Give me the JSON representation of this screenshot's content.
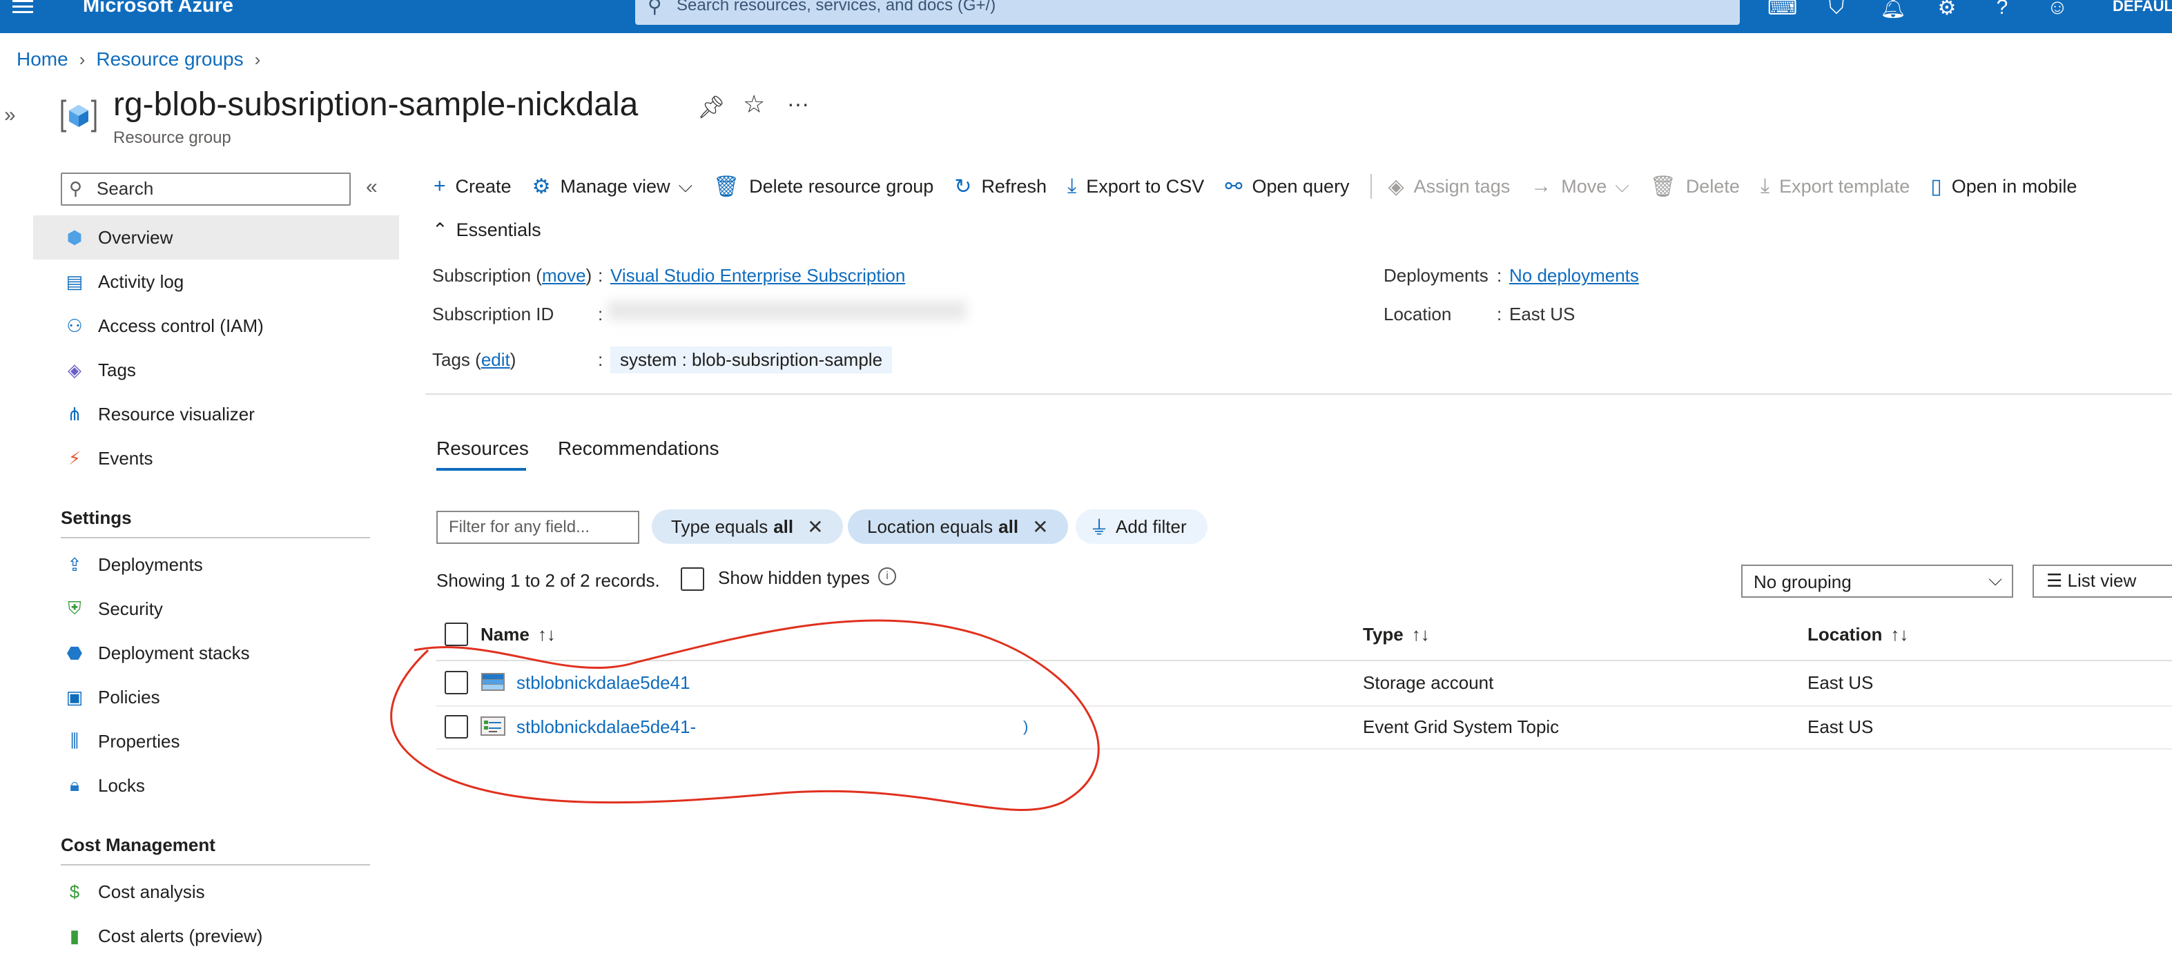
{
  "topbar": {
    "brand": "Microsoft Azure",
    "search_placeholder": "Search resources, services, and docs (G+/)",
    "directory": "DEFAULT"
  },
  "breadcrumb": [
    "Home",
    "Resource groups"
  ],
  "title": {
    "name": "rg-blob-subsription-sample-nickdala",
    "subtitle": "Resource group"
  },
  "nav": {
    "search_placeholder": "Search",
    "items": [
      {
        "label": "Overview",
        "icon": "resource-group-icon",
        "active": true
      },
      {
        "label": "Activity log",
        "icon": "activity-log-icon"
      },
      {
        "label": "Access control (IAM)",
        "icon": "people-icon"
      },
      {
        "label": "Tags",
        "icon": "tag-icon"
      },
      {
        "label": "Resource visualizer",
        "icon": "hierarchy-icon"
      },
      {
        "label": "Events",
        "icon": "lightning-icon"
      }
    ],
    "settings_header": "Settings",
    "settings_items": [
      {
        "label": "Deployments",
        "icon": "upload-icon"
      },
      {
        "label": "Security",
        "icon": "shield-icon"
      },
      {
        "label": "Deployment stacks",
        "icon": "cube-stack-icon"
      },
      {
        "label": "Policies",
        "icon": "policy-icon"
      },
      {
        "label": "Properties",
        "icon": "properties-icon"
      },
      {
        "label": "Locks",
        "icon": "lock-icon"
      }
    ],
    "cost_header": "Cost Management",
    "cost_items": [
      {
        "label": "Cost analysis",
        "icon": "cost-analysis-icon"
      },
      {
        "label": "Cost alerts (preview)",
        "icon": "cost-alert-icon"
      }
    ]
  },
  "commands": {
    "create": "Create",
    "manage_view": "Manage view",
    "delete_rg": "Delete resource group",
    "refresh": "Refresh",
    "export_csv": "Export to CSV",
    "open_query": "Open query",
    "assign_tags": "Assign tags",
    "move": "Move",
    "delete": "Delete",
    "export_template": "Export template",
    "open_mobile": "Open in mobile"
  },
  "essentials": {
    "header": "Essentials",
    "subscription_label": "Subscription",
    "subscription_move": "move",
    "subscription_value": "Visual Studio Enterprise Subscription",
    "subscription_id_label": "Subscription ID",
    "tags_label": "Tags",
    "tags_edit": "edit",
    "tag_value": "system : blob-subsription-sample",
    "deployments_label": "Deployments",
    "deployments_value": "No deployments",
    "location_label": "Location",
    "location_value": "East US",
    "separator": ":"
  },
  "tabs": [
    "Resources",
    "Recommendations"
  ],
  "filters": {
    "placeholder": "Filter for any field...",
    "type_prefix": "Type equals",
    "type_value": "all",
    "location_prefix": "Location equals",
    "location_value": "all",
    "add_filter": "Add filter"
  },
  "records": {
    "showing": "Showing 1 to 2 of 2 records.",
    "show_hidden": "Show hidden types",
    "grouping": "No grouping",
    "view": "List view"
  },
  "table": {
    "columns": [
      "Name",
      "Type",
      "Location"
    ],
    "rows": [
      {
        "name": "stblobnickdalae5de41",
        "type": "Storage account",
        "location": "East US",
        "icon": "storage-account-icon"
      },
      {
        "name": "stblobnickdalae5de41-",
        "type": "Event Grid System Topic",
        "location": "East US",
        "icon": "event-grid-topic-icon"
      }
    ]
  },
  "colors": {
    "azure_blue": "#0f6cbd",
    "annotation_red": "#e0301e"
  }
}
